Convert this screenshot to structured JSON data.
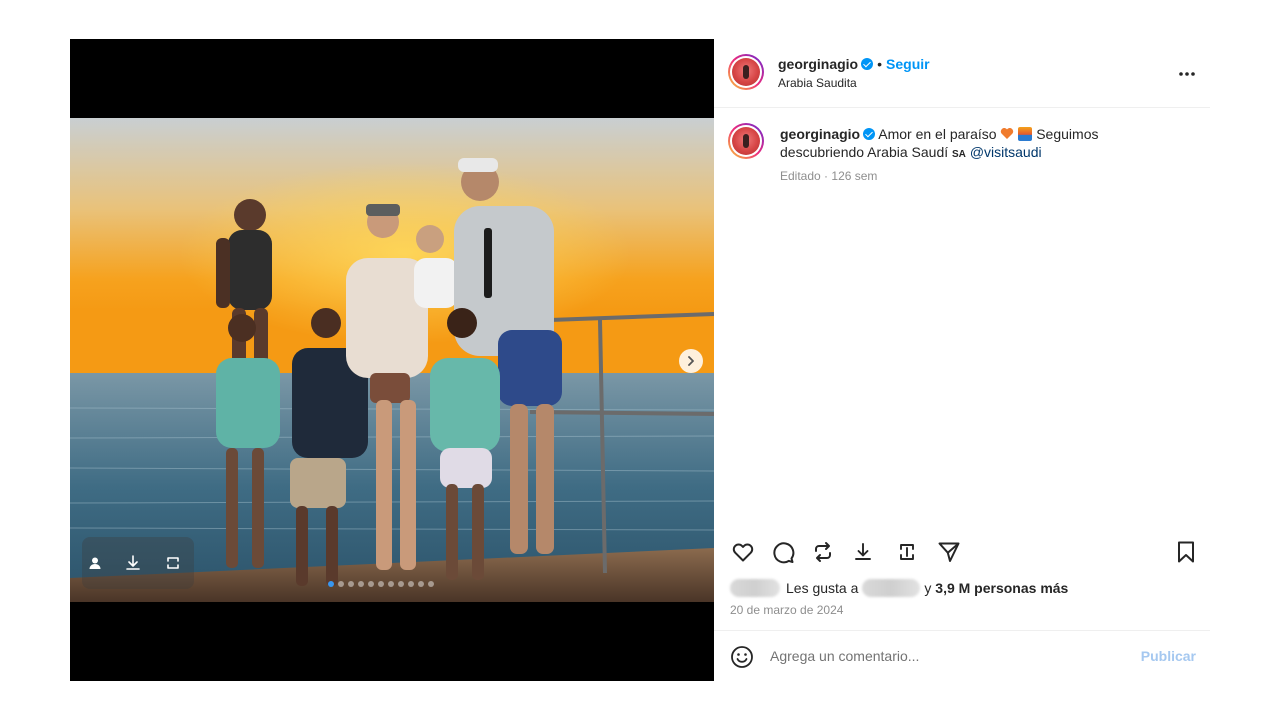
{
  "post": {
    "username": "georginagio",
    "follow_label": "Seguir",
    "separator": "•",
    "location": "Arabia Saudita",
    "more_icon": "…",
    "carousel_dot_count": 11,
    "carousel_active_dot": 0
  },
  "caption": {
    "username": "georginagio",
    "text_part1": "Amor en el paraíso",
    "text_part2": "Seguimos descubriendo Arabia Saudí",
    "flag_text": "SA",
    "mention": "@visitsaudi",
    "edited_label": "Editado",
    "dot": "·",
    "time_ago": "126 sem"
  },
  "likes": {
    "prefix": "Les gusta a",
    "connector": "y",
    "count_text": "3,9 M personas más"
  },
  "date": "20 de marzo de 2024",
  "comment": {
    "placeholder": "Agrega un comentario...",
    "publish_label": "Publicar"
  },
  "colors": {
    "accent_blue": "#0095f6",
    "publish_disabled": "#a5c8f0",
    "muted_text": "#8e8e8e"
  }
}
